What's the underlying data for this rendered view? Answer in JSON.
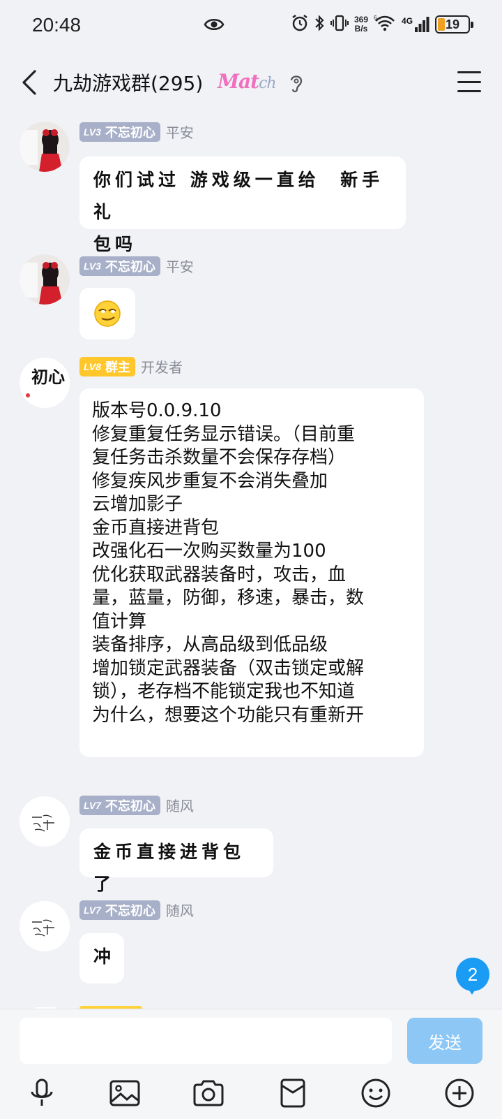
{
  "status_bar": {
    "time": "20:48",
    "net_speed_value": "369",
    "net_speed_unit": "B/s",
    "network": "4G",
    "battery": "19",
    "icons": [
      "eye-icon",
      "alarm-icon",
      "bluetooth-icon",
      "vibrate-icon",
      "wifi-icon",
      "signal-icon",
      "battery-icon"
    ]
  },
  "header": {
    "title": "九劫游戏群(295)",
    "logo_main": "Mat",
    "logo_lite": "ch",
    "icons": [
      "back-icon",
      "ear-icon",
      "menu-icon"
    ]
  },
  "messages": [
    {
      "level": "LV3",
      "title": "不忘初心",
      "nickname": "平安",
      "text": "你们试过 游戏级一直给  新手礼\n包吗"
    },
    {
      "level": "LV3",
      "title": "不忘初心",
      "nickname": "平安",
      "emoji": "smirk-emoji"
    },
    {
      "level": "LV8",
      "title": "群主",
      "nickname": "开发者",
      "avatar_text": "初心",
      "text": "版本号0.0.9.10\n修复重复任务显示错误。（目前重\n复任务击杀数量不会保存存档）\n修复疾风步重复不会消失叠加\n云增加影子\n金币直接进背包\n改强化石一次购买数量为100\n优化获取武器装备时，攻击，血\n量，蓝量，防御，移速，暴击，数\n值计算\n装备排序，从高品级到低品级\n增加锁定武器装备（双击锁定或解\n锁），老存档不能锁定我也不知道\n为什么，想要这个功能只有重新开"
    },
    {
      "level": "LV7",
      "title": "不忘初心",
      "nickname": "随风",
      "text": "金币直接进背包了"
    },
    {
      "level": "LV7",
      "title": "不忘初心",
      "nickname": "随风",
      "text": "冲"
    }
  ],
  "unread_count": "2",
  "input": {
    "value": "",
    "send_label": "发送"
  },
  "toolbar": [
    "microphone-icon",
    "image-icon",
    "camera-icon",
    "red-packet-icon",
    "emoji-icon",
    "plus-icon"
  ]
}
